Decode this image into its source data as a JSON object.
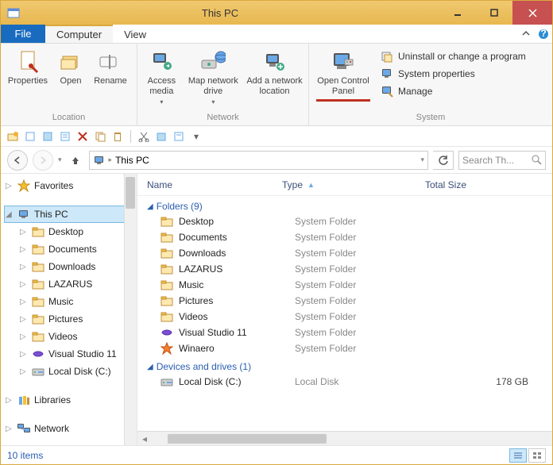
{
  "window": {
    "title": "This PC"
  },
  "menu": {
    "file": "File",
    "tabs": [
      "Computer",
      "View"
    ],
    "active": 0
  },
  "ribbon": {
    "location": {
      "label": "Location",
      "properties": "Properties",
      "open": "Open",
      "rename": "Rename"
    },
    "network": {
      "label": "Network",
      "access_media": "Access media",
      "map_drive": "Map network drive",
      "add_location": "Add a network location"
    },
    "system": {
      "label": "System",
      "open_cp": "Open Control Panel",
      "uninstall": "Uninstall or change a program",
      "sysprops": "System properties",
      "manage": "Manage"
    }
  },
  "address": {
    "location": "This PC"
  },
  "search": {
    "placeholder": "Search Th..."
  },
  "tree": {
    "favorites": "Favorites",
    "thispc": "This PC",
    "children": [
      "Desktop",
      "Documents",
      "Downloads",
      "LAZARUS",
      "Music",
      "Pictures",
      "Videos",
      "Visual Studio 11",
      "Local Disk (C:)"
    ],
    "libraries": "Libraries",
    "network": "Network"
  },
  "columns": {
    "name": "Name",
    "type": "Type",
    "total": "Total Size"
  },
  "groups": {
    "folders": {
      "label": "Folders (9)",
      "items": [
        {
          "name": "Desktop",
          "type": "System Folder",
          "icon": "folder"
        },
        {
          "name": "Documents",
          "type": "System Folder",
          "icon": "folder"
        },
        {
          "name": "Downloads",
          "type": "System Folder",
          "icon": "folder"
        },
        {
          "name": "LAZARUS",
          "type": "System Folder",
          "icon": "folder"
        },
        {
          "name": "Music",
          "type": "System Folder",
          "icon": "folder"
        },
        {
          "name": "Pictures",
          "type": "System Folder",
          "icon": "folder"
        },
        {
          "name": "Videos",
          "type": "System Folder",
          "icon": "folder"
        },
        {
          "name": "Visual Studio 11",
          "type": "System Folder",
          "icon": "vs"
        },
        {
          "name": "Winaero",
          "type": "System Folder",
          "icon": "star"
        }
      ]
    },
    "drives": {
      "label": "Devices and drives (1)",
      "items": [
        {
          "name": "Local Disk (C:)",
          "type": "Local Disk",
          "size": "178 GB",
          "icon": "disk"
        }
      ]
    }
  },
  "status": {
    "count": "10 items"
  }
}
